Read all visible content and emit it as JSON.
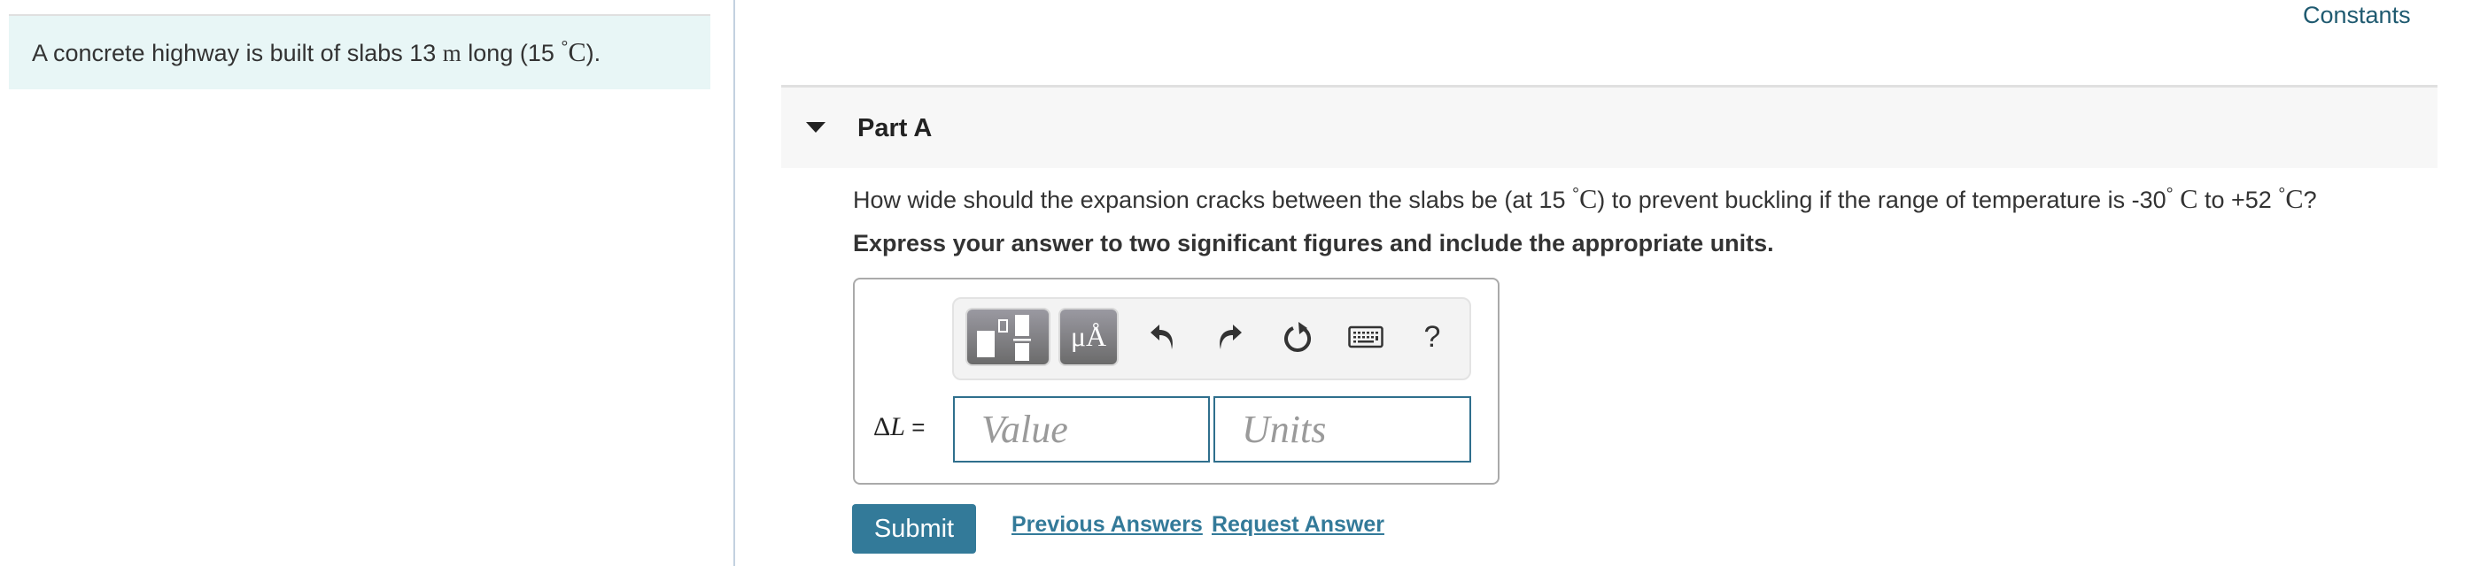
{
  "intro": {
    "text_before": "A concrete highway is built of slabs 13 ",
    "unit_m": "m",
    "text_mid": " long (15 ",
    "deg": "°",
    "unit_c": "C",
    "text_after": ")."
  },
  "header": {
    "constants_link": "Constants"
  },
  "part": {
    "title": "Part A",
    "expanded": true,
    "question": {
      "t1": "How wide should the expansion cracks between the slabs be (at 15 ",
      "deg": "°",
      "c": "C",
      "t2": ") to prevent buckling if the range of temperature is -30",
      "deg2": "°",
      "c2": " C",
      "t3": " to +52 ",
      "deg3": "°",
      "c3": "C",
      "t4": "?"
    },
    "instruction": "Express your answer to two significant figures and include the appropriate units."
  },
  "toolbar": {
    "templates_icon": "templates-icon",
    "units_icon_label": "μÅ",
    "undo_icon": "undo-icon",
    "redo_icon": "redo-icon",
    "reset_icon": "reset-icon",
    "keyboard_icon": "keyboard-icon",
    "help_label": "?"
  },
  "answer": {
    "label_delta": "Δ",
    "label_var": "L",
    "label_eq": " =",
    "value": "",
    "value_placeholder": "Value",
    "units": "",
    "units_placeholder": "Units"
  },
  "actions": {
    "submit": "Submit",
    "previous_answers": "Previous Answers",
    "request_answer": "Request Answer"
  },
  "colors": {
    "accent": "#337a99",
    "intro_bg": "#e8f6f6",
    "divider": "#c3d1e0"
  }
}
